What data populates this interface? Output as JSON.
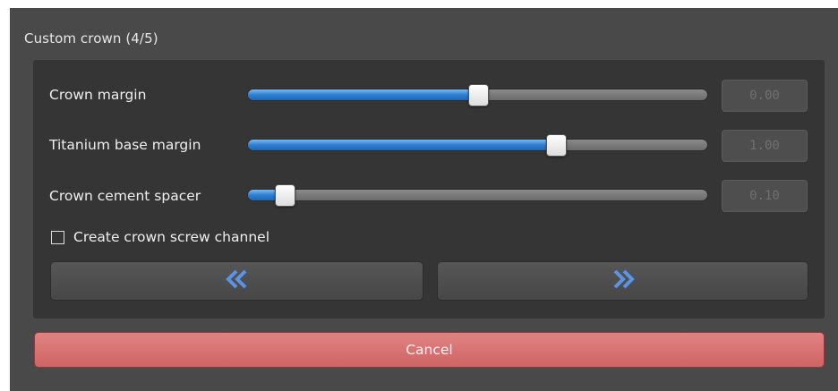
{
  "section": {
    "title": "Custom crown (4/5)"
  },
  "sliders": [
    {
      "label": "Crown margin",
      "value_text": "0.00",
      "fraction": 0.5
    },
    {
      "label": "Titanium base margin",
      "value_text": "1.00",
      "fraction": 0.67
    },
    {
      "label": "Crown cement spacer",
      "value_text": "0.10",
      "fraction": 0.08
    }
  ],
  "checkbox": {
    "label": "Create crown screw channel",
    "checked": false
  },
  "nav": {
    "back_icon": "double-chevron-left-icon",
    "next_icon": "double-chevron-right-icon"
  },
  "cancel": {
    "label": "Cancel"
  },
  "colors": {
    "accent": "#2f7fd1",
    "cancel": "#d96e6e",
    "background": "#494949",
    "panel": "#353535"
  }
}
